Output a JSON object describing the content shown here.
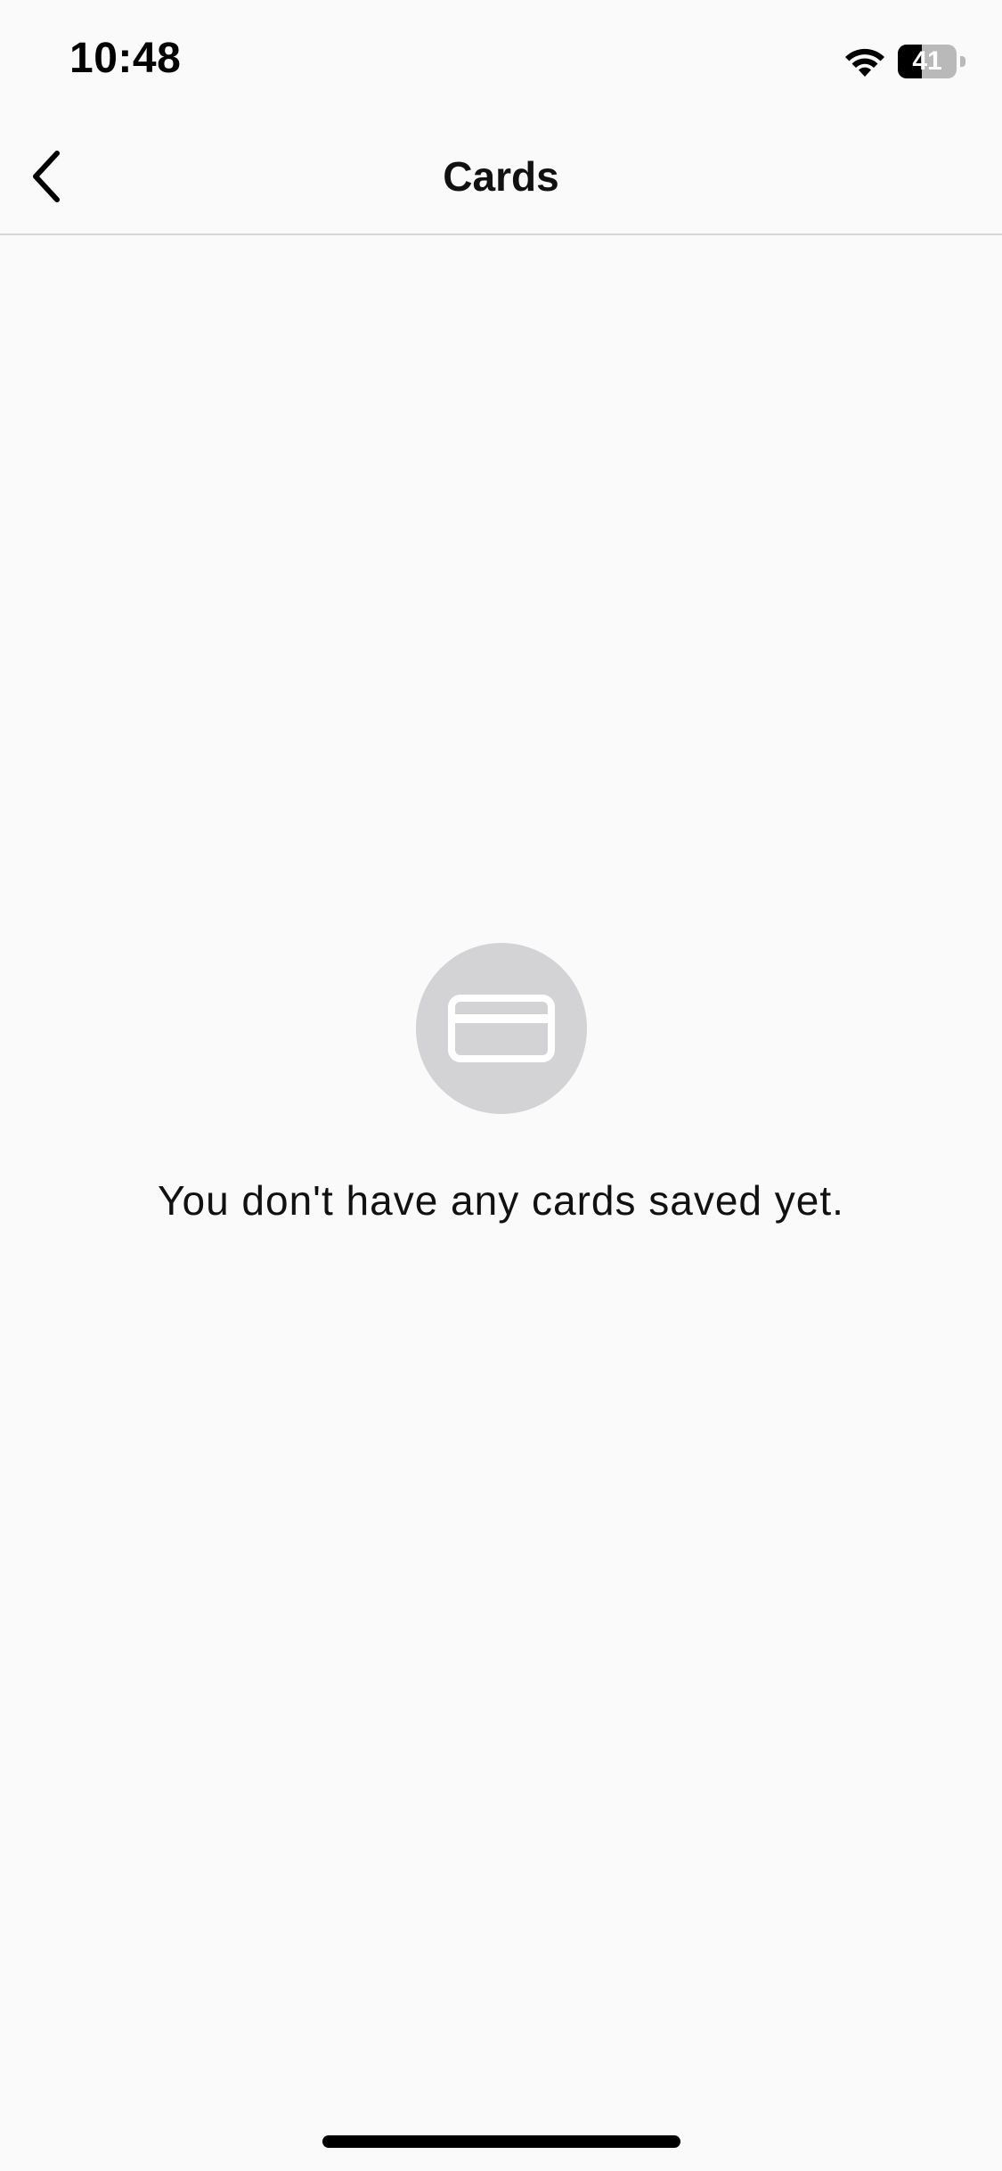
{
  "status_bar": {
    "time": "10:48",
    "battery_level": "41",
    "battery_percent": 41
  },
  "nav": {
    "title": "Cards",
    "back_icon": "chevron-left-icon"
  },
  "empty_state": {
    "icon": "credit-card-icon",
    "message": "You don't have any cards saved yet."
  },
  "colors": {
    "background": "#fafafa",
    "icon_circle": "#d3d3d6",
    "text": "#111111",
    "divider": "#d6d6d6"
  }
}
